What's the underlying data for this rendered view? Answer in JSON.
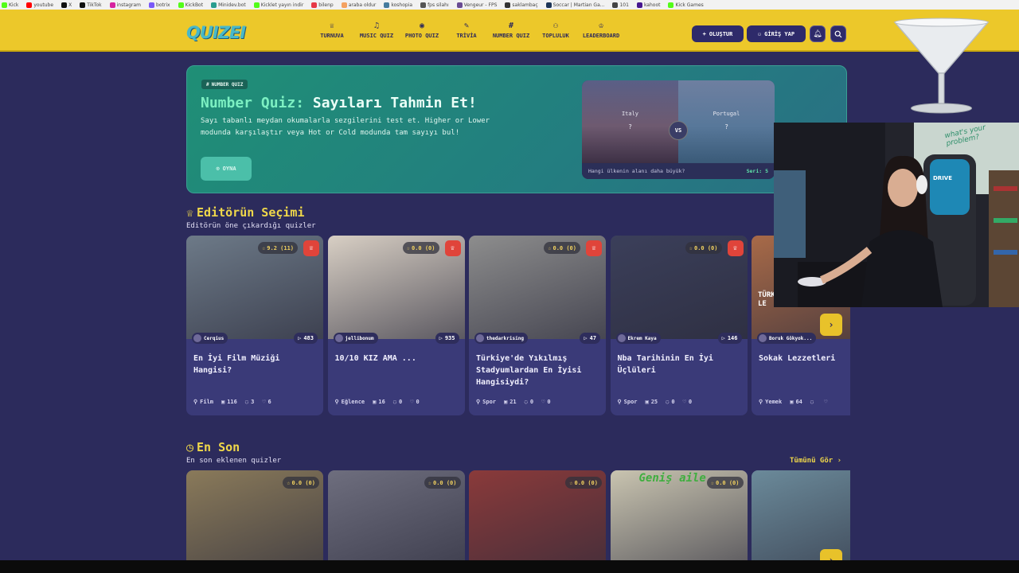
{
  "bookmarks": [
    {
      "label": "Kick",
      "color": "#53fc18"
    },
    {
      "label": "youtube",
      "color": "#ff0000"
    },
    {
      "label": "X",
      "color": "#111111"
    },
    {
      "label": "TikTok",
      "color": "#111111"
    },
    {
      "label": "instagram",
      "color": "#d6249f"
    },
    {
      "label": "botrix",
      "color": "#7a5af8"
    },
    {
      "label": "KickBot",
      "color": "#53fc18"
    },
    {
      "label": "Minidev.bot",
      "color": "#2a9d8f"
    },
    {
      "label": "Kicklet yayın indir",
      "color": "#53fc18"
    },
    {
      "label": "bilenp",
      "color": "#e63946"
    },
    {
      "label": "araba oldur",
      "color": "#f4a261"
    },
    {
      "label": "koshopia",
      "color": "#457b9d"
    },
    {
      "label": "fps silahı",
      "color": "#555555"
    },
    {
      "label": "Vengeur - FPS",
      "color": "#6a4c93"
    },
    {
      "label": "saklambaç",
      "color": "#333333"
    },
    {
      "label": "Soccar | Martian Ga...",
      "color": "#1d3557"
    },
    {
      "label": "101",
      "color": "#444444"
    },
    {
      "label": "kahoot",
      "color": "#46178f"
    },
    {
      "label": "Kick Games",
      "color": "#53fc18"
    }
  ],
  "header": {
    "logo": "QUIZEI",
    "nav": [
      {
        "label": "TURNUVA",
        "icon": "trophy-icon",
        "glyph": "♕"
      },
      {
        "label": "MUSIC QUIZ",
        "icon": "music-icon",
        "glyph": "♫"
      },
      {
        "label": "PHOTO QUIZ",
        "icon": "camera-icon",
        "glyph": "◉"
      },
      {
        "label": "TRİVİA",
        "icon": "chat-icon",
        "glyph": "✎"
      },
      {
        "label": "NUMBER QUIZ",
        "icon": "hash-icon",
        "glyph": "#"
      },
      {
        "label": "TOPLULUK",
        "icon": "users-icon",
        "glyph": "⚇"
      },
      {
        "label": "LEADERBOARD",
        "icon": "award-icon",
        "glyph": "♔"
      }
    ],
    "create_label": "OLUŞTUR",
    "login_label": "GİRİŞ YAP"
  },
  "hero": {
    "badge": "NUMBER QUIZ",
    "title_prefix": "Number Quiz:",
    "title_main": "Sayıları Tahmin Et!",
    "description": "Sayı tabanlı meydan okumalarla sezgilerini test et. Higher or Lower modunda karşılaştır veya Hot or Cold modunda tam sayıyı bul!",
    "play_label": "OYNA",
    "compare": {
      "left_country": "Italy",
      "right_country": "Portugal",
      "mystery": "?",
      "vs": "VS",
      "question": "Hangi ülkenin alanı daha büyük?",
      "streak": "Seri: 5"
    }
  },
  "editors_pick": {
    "title": "Editörün Seçimi",
    "subtitle": "Editörün öne çıkardığı quizler",
    "cards": [
      {
        "title": "En İyi Film Müziği Hangisi?",
        "author": "Cerqius",
        "plays": "483",
        "rating": "9.2 (11)",
        "category": "Film",
        "questions": "116",
        "comments": "3",
        "likes": "6",
        "image_color": "#6d7a88"
      },
      {
        "title": "10/10 KIZ AMA ...",
        "author": "jellibonum",
        "plays": "935",
        "rating": "0.0 (0)",
        "category": "Eğlence",
        "questions": "16",
        "comments": "0",
        "likes": "0",
        "image_color": "#d8cfc4"
      },
      {
        "title": "Türkiye'de Yıkılmış Stadyumlardan En İyisi Hangisiydi?",
        "author": "thedarkrising",
        "plays": "47",
        "rating": "0.0 (0)",
        "category": "Spor",
        "questions": "21",
        "comments": "0",
        "likes": "0",
        "image_color": "#8d8d8d"
      },
      {
        "title": "Nba Tarihinin En İyi Üçlüleri",
        "author": "Ekrem Kaya",
        "plays": "146",
        "rating": "0.0 (0)",
        "category": "Spor",
        "questions": "25",
        "comments": "0",
        "likes": "0",
        "image_color": "#3b3f5a"
      },
      {
        "title": "Sokak Lezzetleri",
        "author": "Boruk Gökyok...",
        "plays": "",
        "rating": "",
        "category": "Yemek",
        "questions": "64",
        "comments": "",
        "likes": "",
        "image_color": "#a86a48",
        "image_text": "TÜRKİYE SOKAK LE"
      }
    ]
  },
  "latest": {
    "title": "En Son",
    "subtitle": "En son eklenen quizler",
    "see_all": "Tümünü Gör",
    "cards": [
      {
        "rating": "0.0 (0)",
        "image_color": "#8a7a5a"
      },
      {
        "rating": "0.0 (0)",
        "image_color": "#6e6e7e"
      },
      {
        "rating": "0.0 (0)",
        "image_color": "#8a3a3a"
      },
      {
        "rating": "0.0 (0)",
        "image_color": "#c9c4b0",
        "image_text": "Geniş aile"
      },
      {
        "rating": "",
        "image_color": "#6b8a9a"
      }
    ]
  },
  "webcam": {
    "overlay_text": "what's your problem?",
    "chair_brand": "DRIVE"
  }
}
